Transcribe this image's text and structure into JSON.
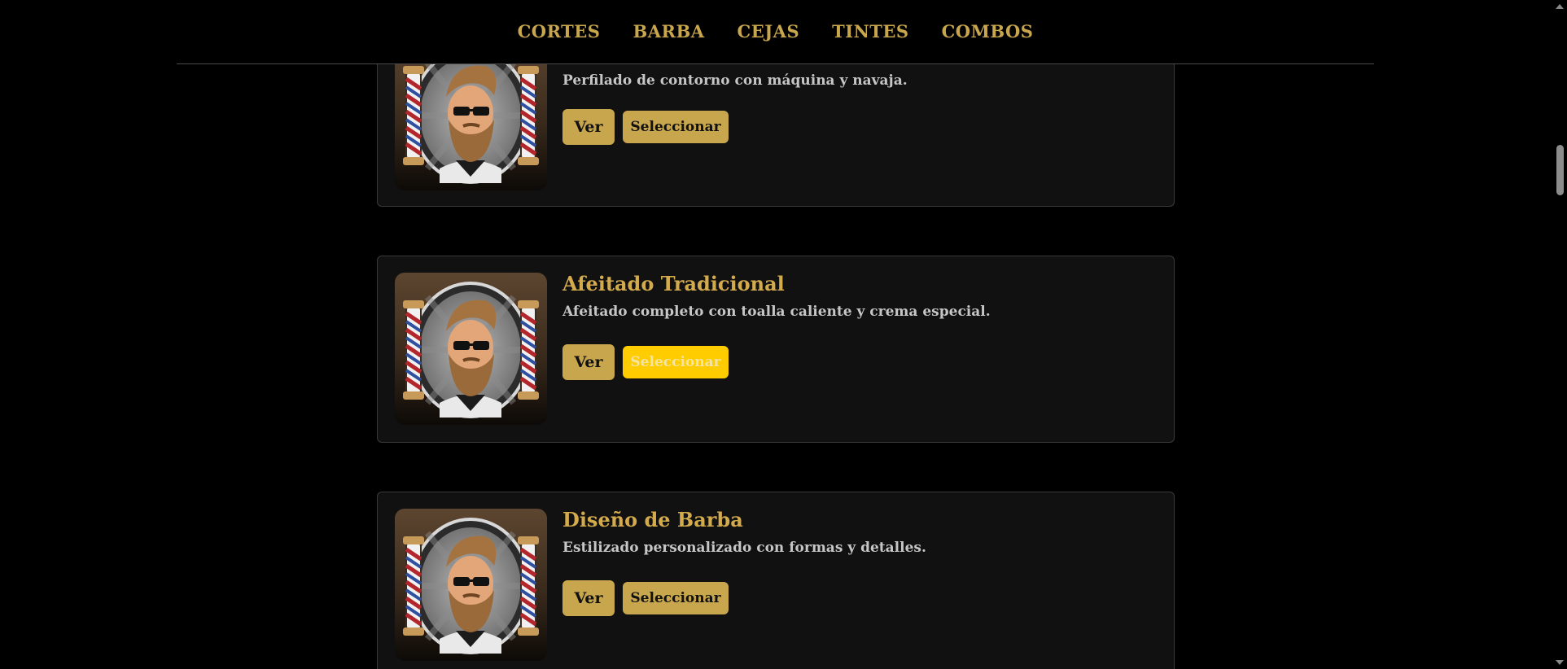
{
  "nav": {
    "items": [
      {
        "label": "CORTES"
      },
      {
        "label": "BARBA"
      },
      {
        "label": "CEJAS"
      },
      {
        "label": "TINTES"
      },
      {
        "label": "COMBOS"
      }
    ]
  },
  "services": [
    {
      "title": "",
      "description": "Perfilado de contorno con máquina y navaja.",
      "view_label": "Ver",
      "select_label": "Seleccionar",
      "selected": false
    },
    {
      "title": "Afeitado Tradicional",
      "description": "Afeitado completo con toalla caliente y crema especial.",
      "view_label": "Ver",
      "select_label": "Seleccionar",
      "selected": true
    },
    {
      "title": "Diseño de Barba",
      "description": "Estilizado personalizado con formas y detalles.",
      "view_label": "Ver",
      "select_label": "Seleccionar",
      "selected": false
    }
  ],
  "colors": {
    "accent": "#c8a64d",
    "accent_active": "#ffcc00",
    "card_bg": "#111111",
    "page_bg": "#000000"
  },
  "icons": {
    "service_image": "barber-logo-icon"
  }
}
